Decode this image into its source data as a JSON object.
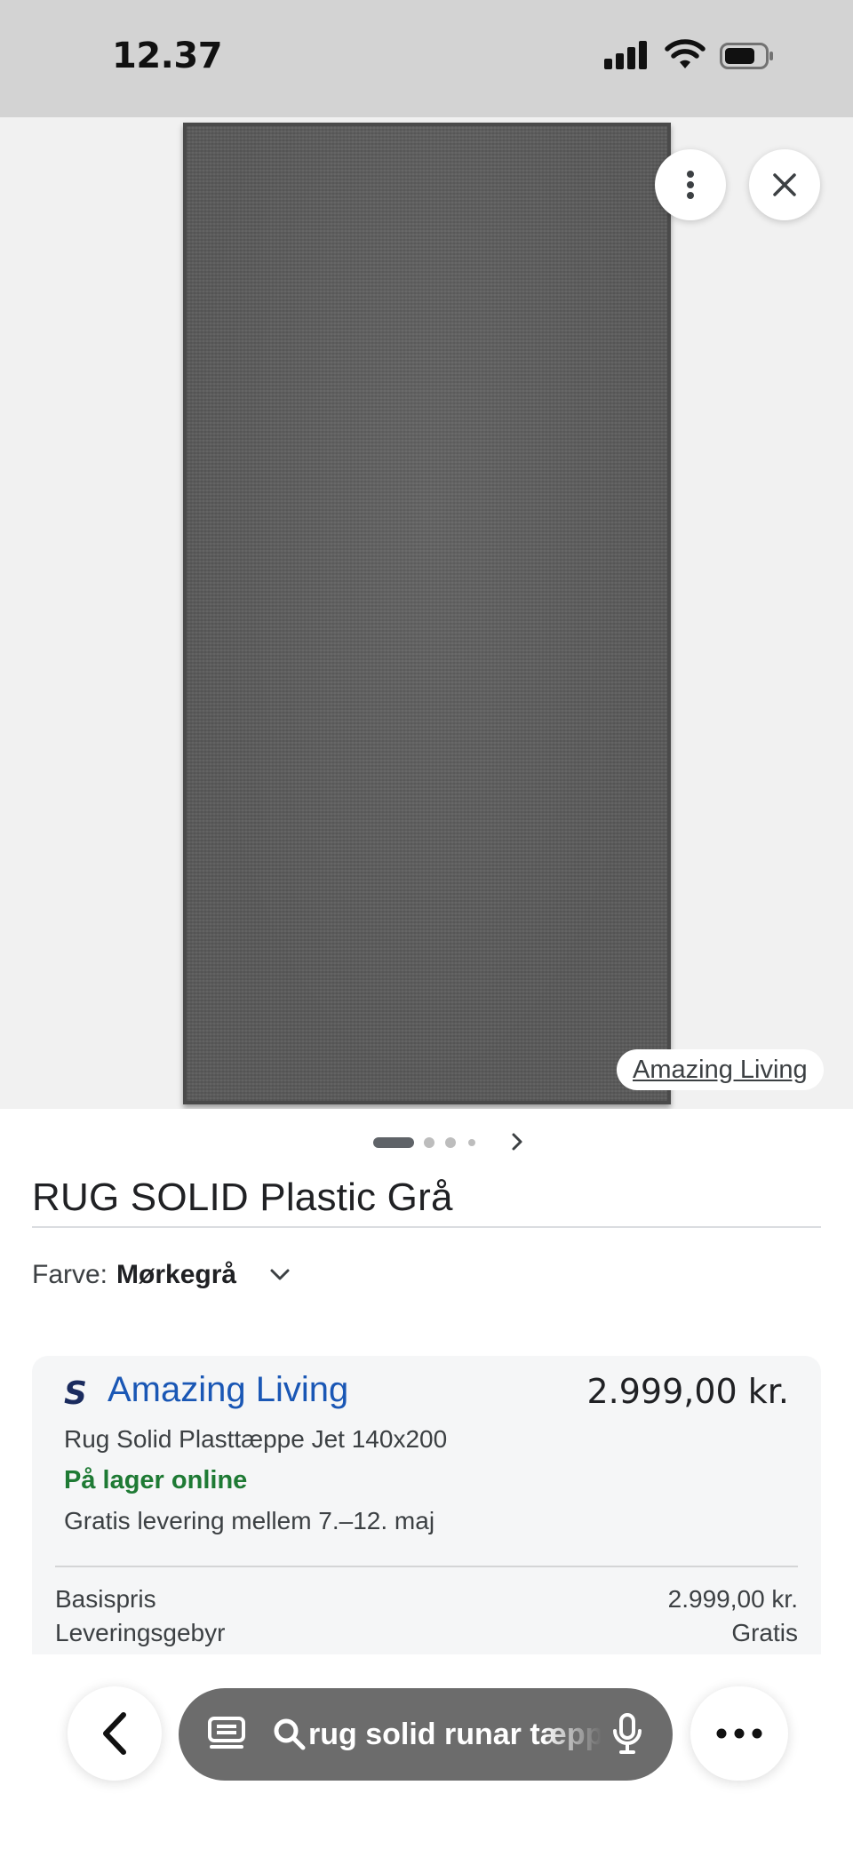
{
  "status_bar": {
    "time": "12.37",
    "icons": [
      "cellular-signal-icon",
      "wifi-icon",
      "battery-icon"
    ]
  },
  "image_viewer": {
    "source_chip": "Amazing Living",
    "pager": {
      "total": 4,
      "active": 1
    },
    "icons": [
      "more-vert-icon",
      "close-icon",
      "chevron-right-icon"
    ]
  },
  "product": {
    "title": "RUG SOLID Plastic Grå",
    "color_label": "Farve:",
    "color_value": "Mørkegrå"
  },
  "offer": {
    "seller_logo": "S",
    "seller_name": "Amazing Living",
    "price": "2.999,00 kr.",
    "product_name": "Rug Solid Plasttæppe Jet 140x200",
    "stock": "På lager online",
    "delivery": "Gratis levering mellem 7.–12. maj",
    "rows": [
      {
        "label": "Basispris",
        "value": "2.999,00 kr."
      },
      {
        "label": "Leveringsgebyr",
        "value": "Gratis"
      }
    ]
  },
  "bottom_bar": {
    "search_text": "rug solid runar tæppe",
    "icons": [
      "back-icon",
      "tabs-icon",
      "search-icon",
      "mic-icon",
      "more-horiz-icon"
    ]
  },
  "colors": {
    "status_bar_bg": "#d3d3d3",
    "seller_link": "#1a57b5",
    "in_stock": "#1e7a34",
    "search_pill": "#6c6c6c"
  }
}
